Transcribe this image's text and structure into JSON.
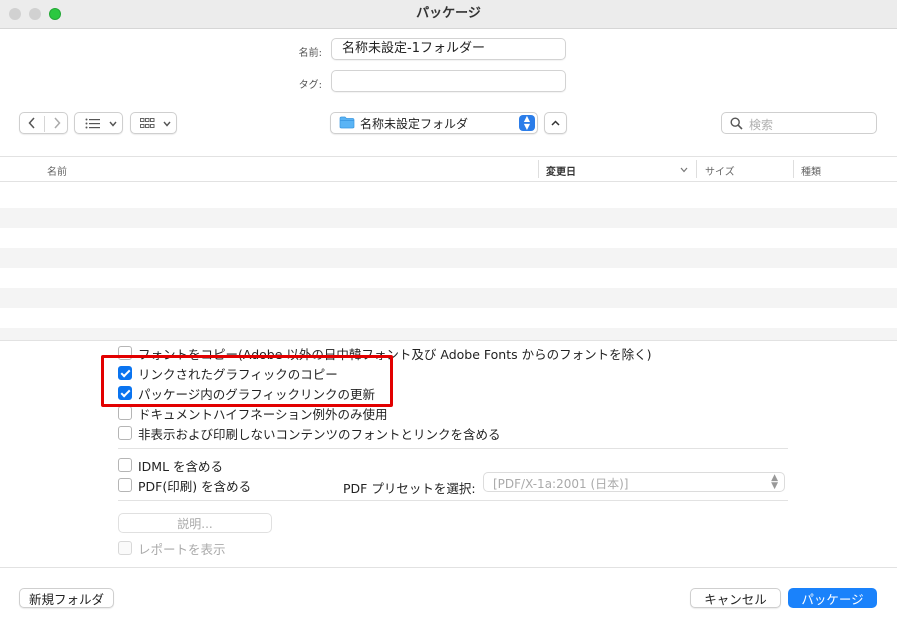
{
  "window": {
    "title": "パッケージ"
  },
  "form": {
    "name_label": "名前:",
    "name_value": "名称未設定-1フォルダー",
    "tags_label": "タグ:",
    "tags_value": ""
  },
  "toolbar": {
    "back_icon": "chevron-left-icon",
    "forward_icon": "chevron-right-icon",
    "list_view_icon": "list-icon",
    "grid_view_icon": "grid-icon",
    "location": "名称未設定フォルダ",
    "search_placeholder": "検索"
  },
  "columns": {
    "name": "名前",
    "date_modified": "変更日",
    "size": "サイズ",
    "kind": "種類"
  },
  "options": {
    "copy_fonts": "フォントをコピー(Adobe 以外の日中韓フォント及び Adobe Fonts からのフォントを除く)",
    "copy_linked_graphics": "リンクされたグラフィックのコピー",
    "update_graphic_links": "パッケージ内のグラフィックリンクの更新",
    "hyphenation_exceptions": "ドキュメントハイフネーション例外のみ使用",
    "include_hidden": "非表示および印刷しないコンテンツのフォントとリンクを含める",
    "include_idml": "IDML を含める",
    "include_pdf": "PDF(印刷) を含める",
    "pdf_preset_label": "PDF プリセットを選択:",
    "pdf_preset_value": "[PDF/X-1a:2001 (日本)]",
    "instructions_button": "説明...",
    "view_report": "レポートを表示"
  },
  "checked": {
    "copy_fonts": false,
    "copy_linked_graphics": true,
    "update_graphic_links": true,
    "hyphenation_exceptions": false,
    "include_hidden": false,
    "include_idml": false,
    "include_pdf": false,
    "view_report": false
  },
  "footer": {
    "new_folder": "新規フォルダ",
    "cancel": "キャンセル",
    "package": "パッケージ"
  },
  "colors": {
    "accent": "#1a82fb",
    "highlight_box": "#e20000"
  }
}
